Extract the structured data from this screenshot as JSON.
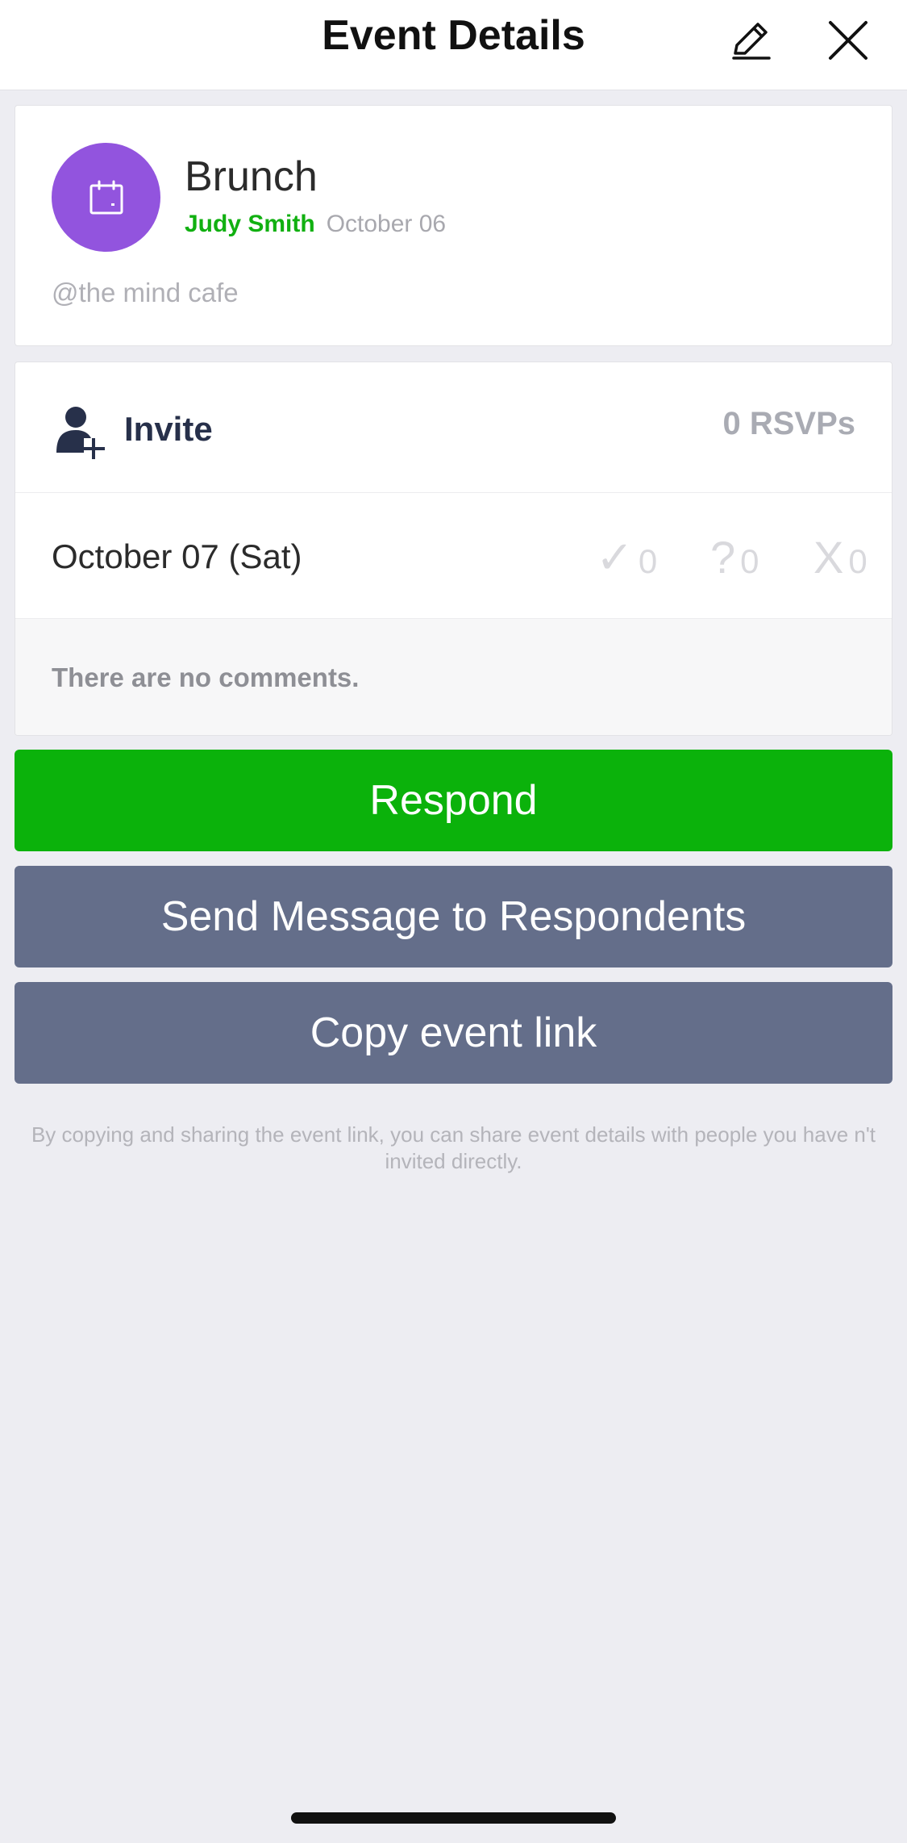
{
  "header": {
    "title": "Event Details",
    "edit_icon": "pencil-icon",
    "close_icon": "close-icon"
  },
  "event": {
    "icon": "calendar-icon",
    "title": "Brunch",
    "organizer": "Judy Smith",
    "created_date": "October 06",
    "location": "@the mind cafe"
  },
  "rsvp": {
    "invite_icon": "add-person-icon",
    "invite_label": "Invite",
    "rsvp_count": "0 RSVPs",
    "date_label": "October 07 (Sat)",
    "yes_symbol": "✓",
    "yes_count": "0",
    "maybe_symbol": "?",
    "maybe_count": "0",
    "no_symbol": "X",
    "no_count": "0",
    "comments_text": "There are no comments."
  },
  "actions": {
    "respond_label": "Respond",
    "message_label": "Send Message to Respondents",
    "copy_label": "Copy event link",
    "share_note": "By copying and sharing the event link, you can share event details with people you have n't invited directly."
  },
  "colors": {
    "accent_green": "#0bb20b",
    "organizer_green": "#11b011",
    "avatar_purple": "#9254de",
    "secondary_button": "#646e8a",
    "background": "#ededf2"
  }
}
